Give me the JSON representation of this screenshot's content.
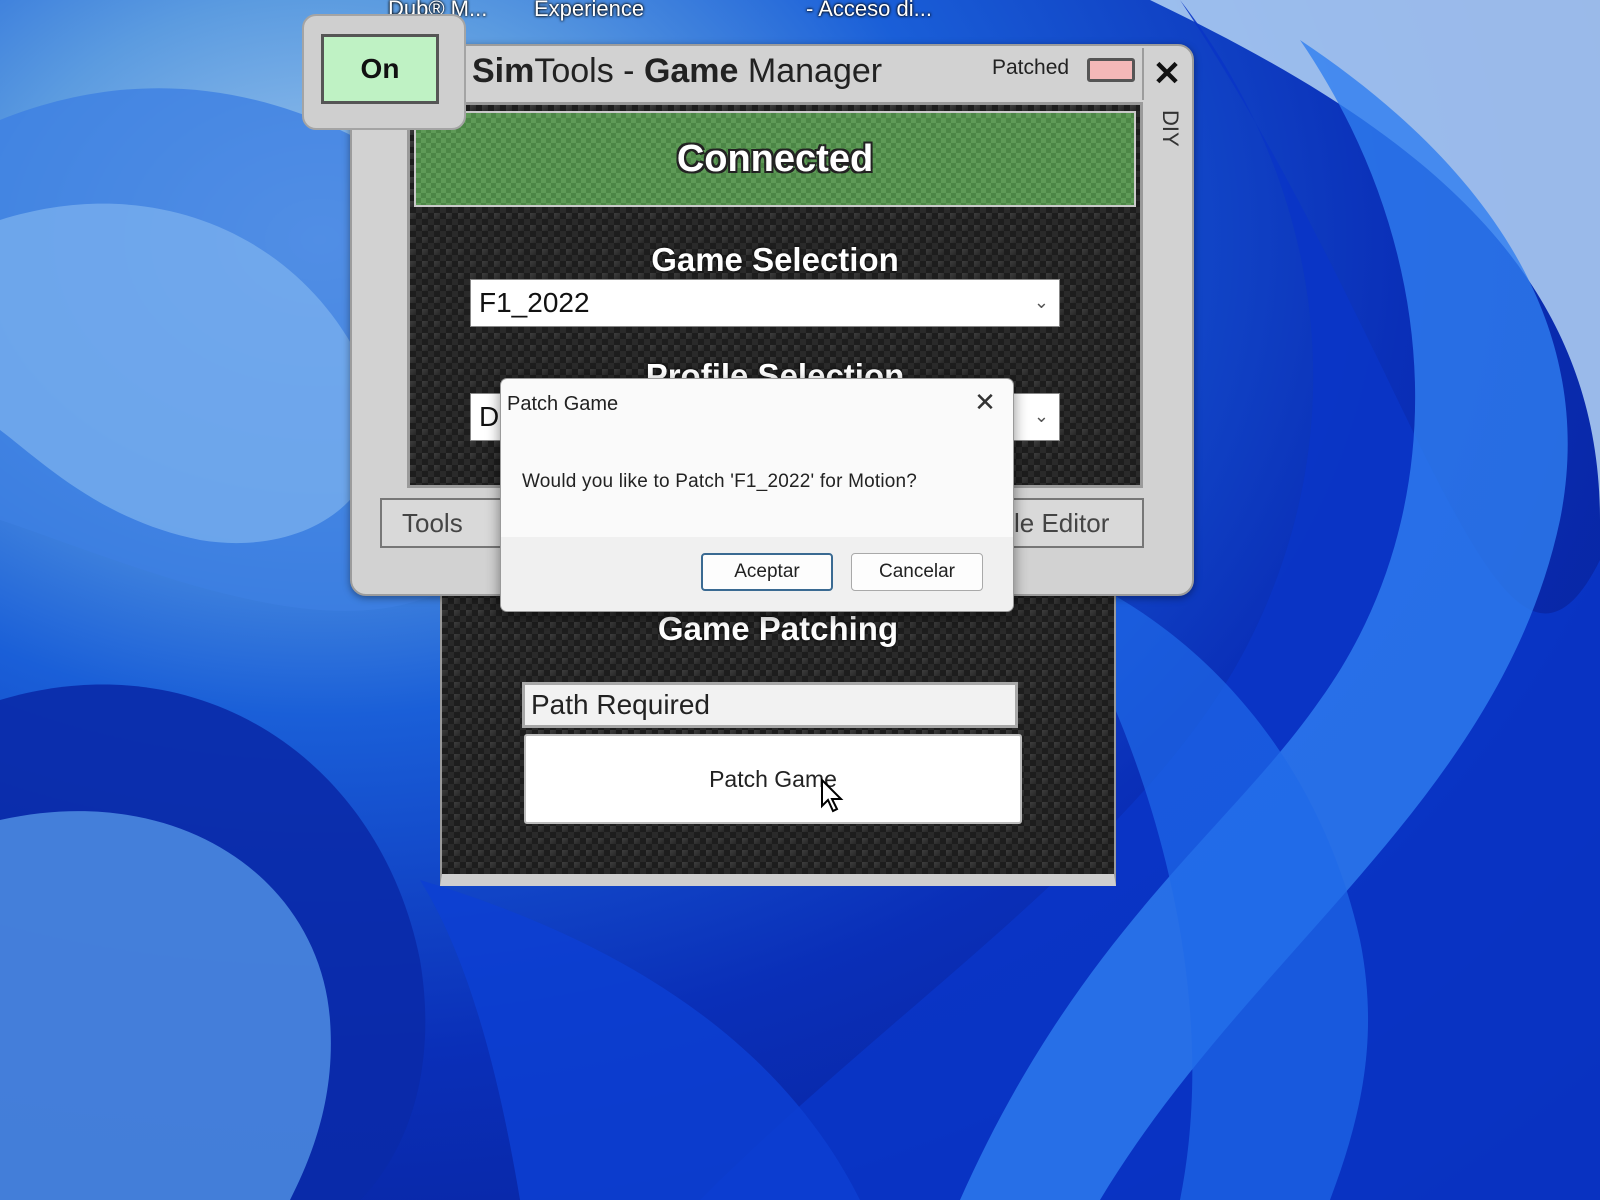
{
  "desktop": {
    "shortcut_labels": [
      "Dub® M...",
      "Experience",
      "- Acceso di..."
    ]
  },
  "manager": {
    "power_button": "On",
    "title_part1": "Sim",
    "title_part2": "Tools",
    "title_part3": " - ",
    "title_part4": "Game",
    "title_part5": " Manager",
    "patched_label": "Patched",
    "close_label": "✕",
    "side_tab": "DIY",
    "status": "Connected",
    "game_selection_label": "Game Selection",
    "game_selected": "F1_2022",
    "profile_selection_label": "Profile Selection",
    "profile_selected": "D",
    "tools_button": "Tools",
    "editor_button": "le Editor",
    "patched_indicator_color": "#f4b8b8",
    "connected_color": "#5e9a57"
  },
  "patching": {
    "title": "Game Patching",
    "path_field": "Path Required",
    "patch_button": "Patch Game"
  },
  "dialog": {
    "title": "Patch Game",
    "message": "Would you like to Patch 'F1_2022' for Motion?",
    "accept": "Aceptar",
    "cancel": "Cancelar",
    "close_label": "✕"
  }
}
